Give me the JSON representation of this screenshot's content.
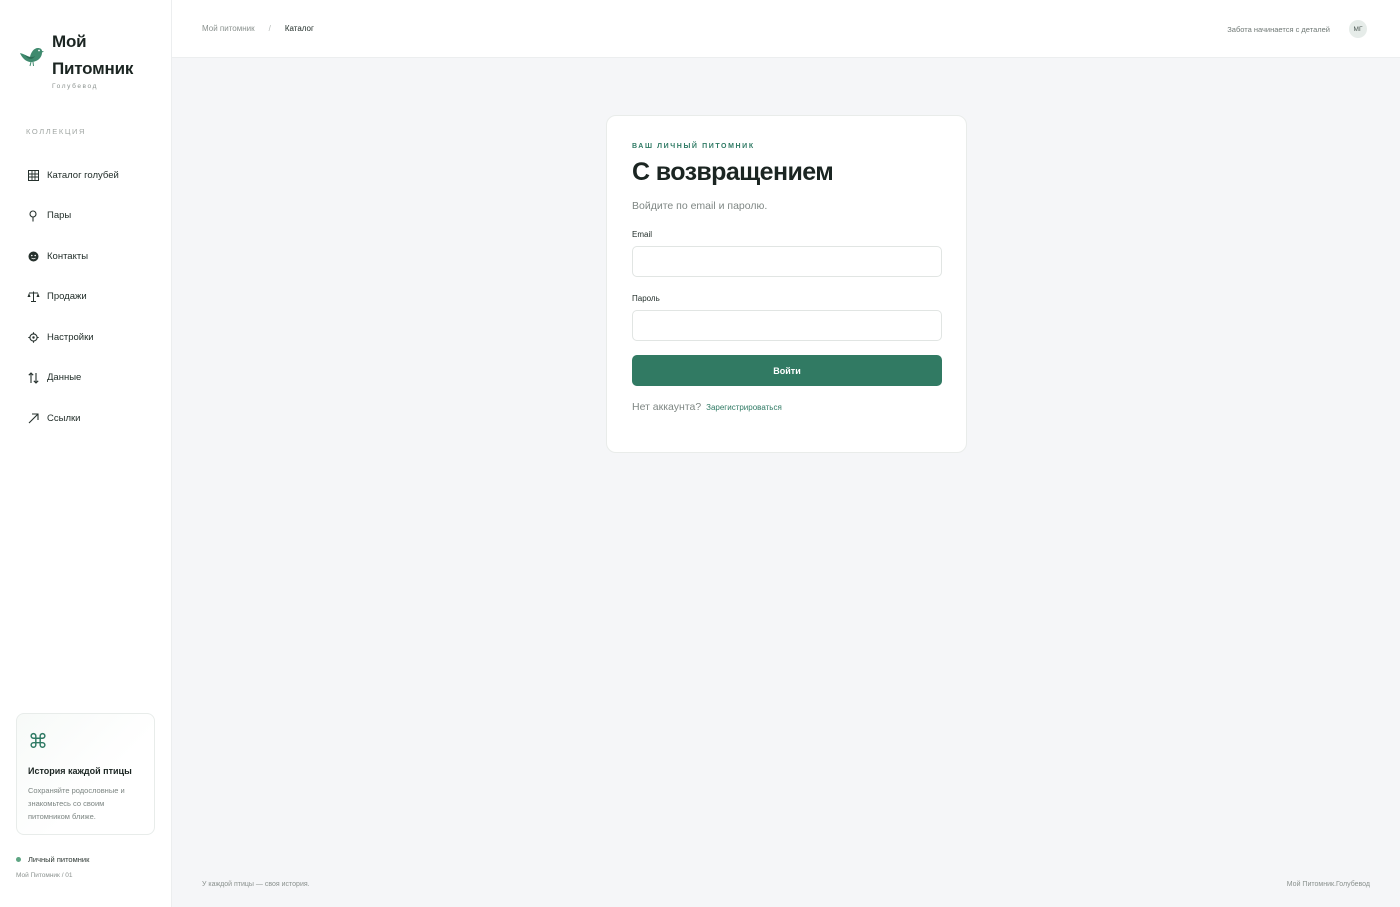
{
  "brand": {
    "title_line1": "Мой",
    "title_line2": "Питомник",
    "subtitle": "Голубевод",
    "accent_color": "#317a63"
  },
  "sidebar": {
    "section_label": "КОЛЛЕКЦИЯ",
    "items": [
      {
        "label": "Каталог голубей",
        "icon": "grid-icon"
      },
      {
        "label": "Пары",
        "icon": "pin-icon"
      },
      {
        "label": "Контакты",
        "icon": "face-icon"
      },
      {
        "label": "Продажи",
        "icon": "scales-icon"
      },
      {
        "label": "Настройки",
        "icon": "gear-icon"
      },
      {
        "label": "Данные",
        "icon": "arrows-updown-icon"
      },
      {
        "label": "Ссылки",
        "icon": "arrow-up-right-icon"
      }
    ],
    "promo": {
      "icon": "command-icon",
      "title": "История каждой птицы",
      "text": "Сохраняйте родословные и знакомьтесь со своим питомником ближе."
    },
    "status": {
      "label": "Личный питомник",
      "sub": "Мой Питомник / 01"
    }
  },
  "header": {
    "breadcrumb": [
      "Мой питомник",
      "/",
      "Каталог"
    ],
    "tagline": "Забота начинается с деталей",
    "avatar_initials": "МГ"
  },
  "login": {
    "eyebrow": "ВАШ ЛИЧНЫЙ ПИТОМНИК",
    "title": "С возвращением",
    "subtitle": "Войдите по email и паролю.",
    "email_label": "Email",
    "email_value": "",
    "password_label": "Пароль",
    "password_value": "",
    "submit_label": "Войти",
    "signup_prompt": "Нет аккаунта?",
    "signup_link": "Зарегистрироваться"
  },
  "footer": {
    "left": "У каждой птицы — своя история.",
    "right": "Мой Питомник.Голубевод"
  }
}
